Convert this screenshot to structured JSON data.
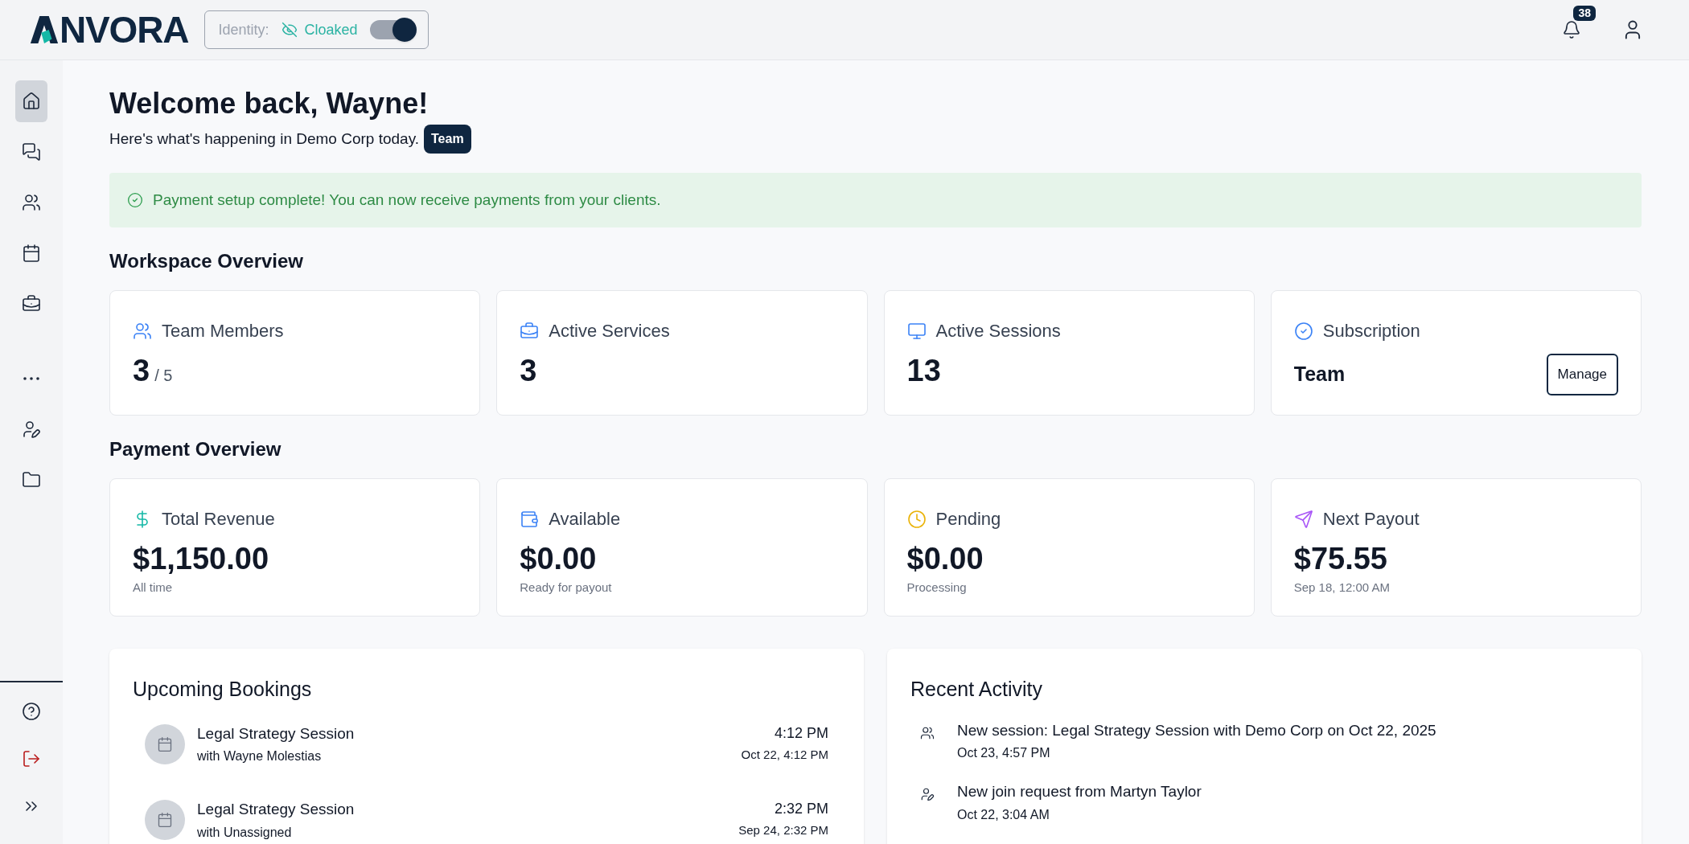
{
  "header": {
    "logo": "NVORA",
    "identity": {
      "label": "Identity:",
      "status": "Cloaked",
      "on": true
    },
    "notifications": {
      "count": "38"
    }
  },
  "sidebar": {
    "items": [
      {
        "kind": "home",
        "selected": true
      },
      {
        "kind": "chat",
        "selected": false
      },
      {
        "kind": "team",
        "selected": false
      },
      {
        "kind": "calendar",
        "selected": false
      },
      {
        "kind": "briefcase",
        "selected": false
      },
      {
        "kind": "more",
        "selected": false
      },
      {
        "kind": "user-edit",
        "selected": false
      },
      {
        "kind": "folder",
        "selected": false
      }
    ],
    "footer": [
      {
        "kind": "help"
      },
      {
        "kind": "logout"
      },
      {
        "kind": "expand"
      }
    ]
  },
  "welcome": {
    "title": "Welcome back, Wayne!",
    "subtitle": "Here's what's happening in Demo Corp today.",
    "badge": "Team"
  },
  "alert": {
    "message": "Payment setup complete! You can now receive payments from your clients."
  },
  "workspace_overview": {
    "title": "Workspace Overview",
    "cards": [
      {
        "kind": "team",
        "label": "Team Members",
        "value": "3",
        "suffix": "/ 5"
      },
      {
        "kind": "services",
        "label": "Active Services",
        "value": "3"
      },
      {
        "kind": "sessions",
        "label": "Active Sessions",
        "value": "13"
      },
      {
        "kind": "subscription",
        "label": "Subscription",
        "value": "Team",
        "button": "Manage"
      }
    ]
  },
  "payment_overview": {
    "title": "Payment Overview",
    "cards": [
      {
        "kind": "revenue",
        "label": "Total Revenue",
        "value": "$1,150.00",
        "note": "All time"
      },
      {
        "kind": "available",
        "label": "Available",
        "value": "$0.00",
        "note": "Ready for payout"
      },
      {
        "kind": "pending",
        "label": "Pending",
        "value": "$0.00",
        "note": "Processing"
      },
      {
        "kind": "payout",
        "label": "Next Payout",
        "value": "$75.55",
        "note": "Sep 18, 12:00 AM"
      }
    ]
  },
  "upcoming_bookings": {
    "title": "Upcoming Bookings",
    "items": [
      {
        "title": "Legal Strategy Session",
        "with": "with Wayne Molestias",
        "time": "4:12 PM",
        "date": "Oct 22, 4:12 PM"
      },
      {
        "title": "Legal Strategy Session",
        "with": "with Unassigned",
        "time": "2:32 PM",
        "date": "Sep 24, 2:32 PM"
      }
    ]
  },
  "recent_activity": {
    "title": "Recent Activity",
    "items": [
      {
        "kind": "session",
        "text": "New session: Legal Strategy Session with Demo Corp on Oct 22, 2025",
        "time": "Oct 23, 4:57 PM"
      },
      {
        "kind": "join",
        "text": "New join request from Martyn Taylor",
        "time": "Oct 22, 3:04 AM"
      }
    ]
  }
}
